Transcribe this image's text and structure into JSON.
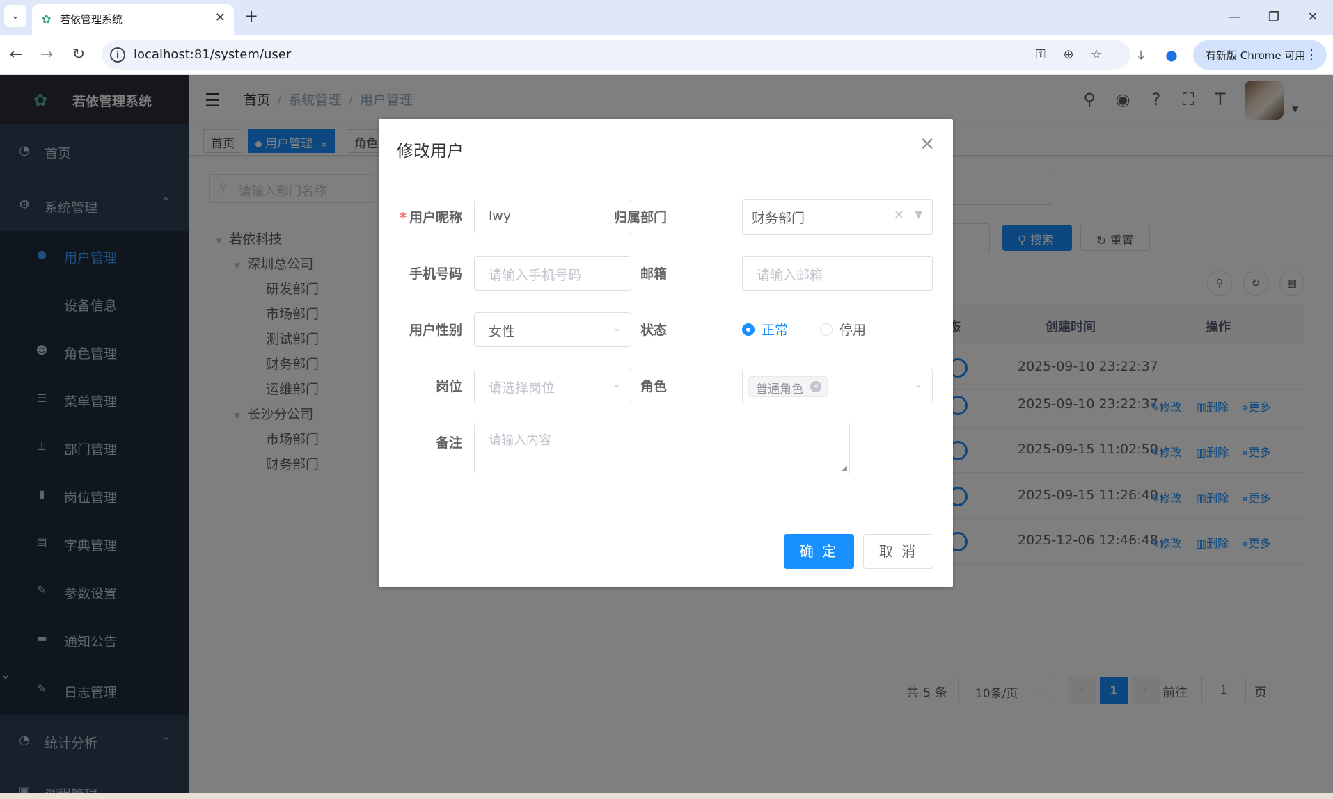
{
  "browser": {
    "tab_title": "若依管理系统",
    "url": "localhost:81/system/user",
    "update_label": "有新版 Chrome 可用"
  },
  "app": {
    "logo_title": "若依管理系统"
  },
  "sidebar": {
    "items": [
      {
        "label": "首页",
        "icon": "dashboard-icon"
      },
      {
        "label": "系统管理",
        "icon": "gear-icon"
      },
      {
        "label": "统计分析",
        "icon": "dashboard-icon"
      },
      {
        "label": "调程管理",
        "icon": "folder-icon"
      }
    ],
    "sub_items": [
      {
        "label": "用户管理",
        "icon": "user-icon",
        "active": true
      },
      {
        "label": "设备信息",
        "icon": "",
        "active": false
      },
      {
        "label": "角色管理",
        "icon": "people-icon",
        "active": false
      },
      {
        "label": "菜单管理",
        "icon": "tree-table-icon",
        "active": false
      },
      {
        "label": "部门管理",
        "icon": "tree-icon",
        "active": false
      },
      {
        "label": "岗位管理",
        "icon": "post-icon",
        "active": false
      },
      {
        "label": "字典管理",
        "icon": "dict-icon",
        "active": false
      },
      {
        "label": "参数设置",
        "icon": "edit-icon",
        "active": false
      },
      {
        "label": "通知公告",
        "icon": "message-icon",
        "active": false
      },
      {
        "label": "日志管理",
        "icon": "log-icon",
        "active": false
      }
    ]
  },
  "navbar": {
    "breadcrumb": [
      "首页",
      "系统管理",
      "用户管理"
    ]
  },
  "tags": [
    "首页",
    "用户管理",
    "角色"
  ],
  "dept_tree": {
    "search_placeholder": "请输入部门名称",
    "nodes": [
      {
        "label": "若依科技",
        "level": 0
      },
      {
        "label": "深圳总公司",
        "level": 1
      },
      {
        "label": "研发部门",
        "level": 2
      },
      {
        "label": "市场部门",
        "level": 2
      },
      {
        "label": "测试部门",
        "level": 2
      },
      {
        "label": "财务部门",
        "level": 2
      },
      {
        "label": "运维部门",
        "level": 2
      },
      {
        "label": "长沙分公司",
        "level": 1
      },
      {
        "label": "市场部门",
        "level": 2
      },
      {
        "label": "财务部门",
        "level": 2
      }
    ]
  },
  "toolbar": {
    "search_label": "搜索",
    "reset_label": "重置"
  },
  "table": {
    "headers": [
      "态",
      "创建时间",
      "操作"
    ],
    "rows": [
      {
        "created": "2025-09-10 23:22:37",
        "ops": false
      },
      {
        "created": "2025-09-10 23:22:37",
        "ops": true
      },
      {
        "created": "2025-09-15 11:02:50",
        "ops": true
      },
      {
        "created": "2025-09-15 11:26:40",
        "ops": true
      },
      {
        "created": "2025-12-06 12:46:48",
        "ops": true
      }
    ],
    "op_edit": "修改",
    "op_delete": "删除",
    "op_more": "更多"
  },
  "pagination": {
    "total": "共 5 条",
    "page_size": "10条/页",
    "current_page": "1",
    "goto_label": "前往",
    "goto_value": "1",
    "page_suffix": "页"
  },
  "dialog": {
    "title": "修改用户",
    "nickname_label": "用户昵称",
    "nickname_value": "lwy",
    "dept_label": "归属部门",
    "dept_value": "财务部门",
    "phone_label": "手机号码",
    "phone_placeholder": "请输入手机号码",
    "email_label": "邮箱",
    "email_placeholder": "请输入邮箱",
    "gender_label": "用户性别",
    "gender_value": "女性",
    "status_label": "状态",
    "status_options": [
      "正常",
      "停用"
    ],
    "status_selected": "正常",
    "post_label": "岗位",
    "post_placeholder": "请选择岗位",
    "role_label": "角色",
    "role_chip": "普通角色",
    "remark_label": "备注",
    "remark_placeholder": "请输入内容",
    "confirm_label": "确 定",
    "cancel_label": "取 消"
  },
  "colors": {
    "primary": "#1890ff",
    "sidebar_bg": "#304156",
    "submenu_bg": "#1f2d3d",
    "danger": "#f56c6c"
  }
}
